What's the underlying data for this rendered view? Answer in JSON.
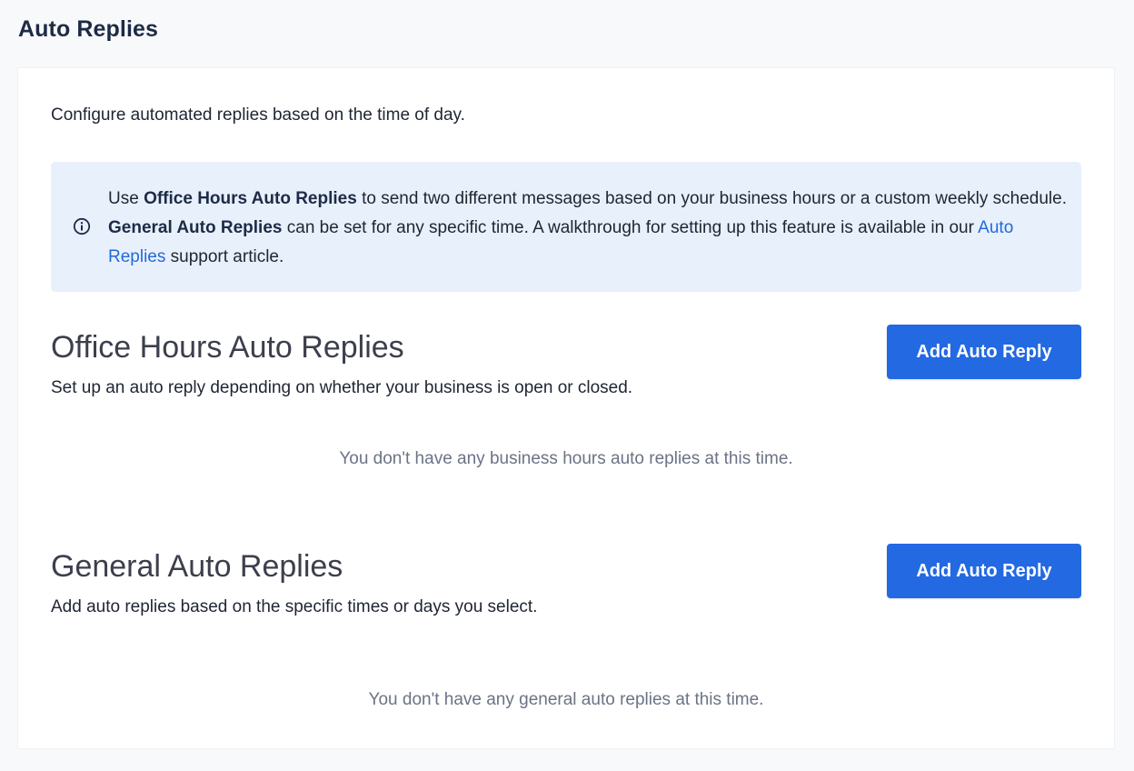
{
  "page": {
    "title": "Auto Replies"
  },
  "intro": "Configure automated replies based on the time of day.",
  "info": {
    "icon": "info-circle-icon",
    "t1": "Use ",
    "b1": "Office Hours Auto Replies",
    "t2": " to send two different messages based on your business hours or a custom weekly schedule. ",
    "b2": "General Auto Replies",
    "t3": " can be set for any specific time. A walkthrough for setting up this feature is available in our ",
    "link": "Auto Replies",
    "t4": " support article."
  },
  "office_hours": {
    "title": "Office Hours Auto Replies",
    "description": "Set up an auto reply depending on whether your business is open or closed.",
    "button_label": "Add Auto Reply",
    "empty_message": "You don't have any business hours auto replies at this time."
  },
  "general": {
    "title": "General Auto Replies",
    "description": "Add auto replies based on the specific times or days you select.",
    "button_label": "Add Auto Reply",
    "empty_message": "You don't have any general auto replies at this time."
  },
  "colors": {
    "primary_button": "#2369e2",
    "link": "#2369d9",
    "info_background": "#e8f0fc",
    "page_background": "#f8f9fb"
  }
}
